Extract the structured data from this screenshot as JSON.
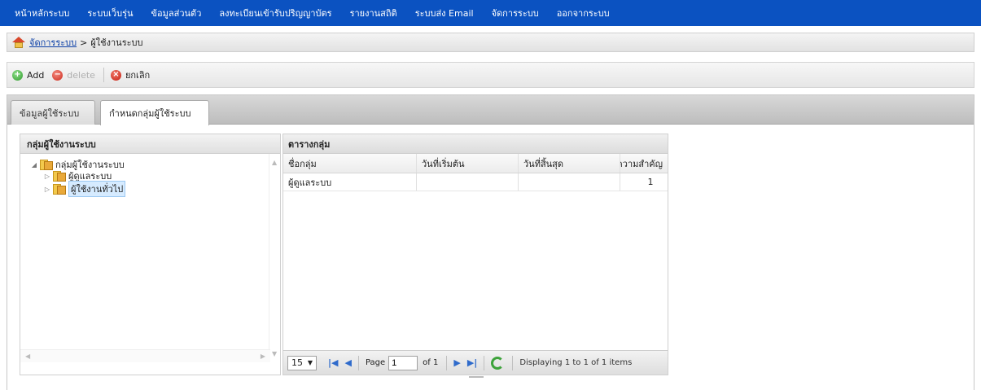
{
  "nav": {
    "items": [
      {
        "label": "หน้าหลักระบบ"
      },
      {
        "label": "ระบบเว็บรุ่น"
      },
      {
        "label": "ข้อมูลส่วนตัว"
      },
      {
        "label": "ลงทะเบียนเข้ารับปริญญาบัตร"
      },
      {
        "label": "รายงานสถิติ"
      },
      {
        "label": "ระบบส่ง Email"
      },
      {
        "label": "จัดการระบบ"
      },
      {
        "label": "ออกจากระบบ"
      }
    ]
  },
  "breadcrumb": {
    "link": "จัดการระบบ",
    "separator": ">",
    "current": "ผู้ใช้งานระบบ"
  },
  "toolbar": {
    "add": "Add",
    "delete": "delete",
    "cancel": "ยกเลิก"
  },
  "tabs": [
    {
      "label": "ข้อมูลผู้ใช้ระบบ"
    },
    {
      "label": "กำหนดกลุ่มผู้ใช้ระบบ"
    }
  ],
  "tree": {
    "title": "กลุ่มผู้ใช้งานระบบ",
    "root": "กลุ่มผู้ใช้งานระบบ",
    "children": [
      "ผู้ดูแลระบบ",
      "ผู้ใช้งานทั่วไป"
    ]
  },
  "grid": {
    "title": "ตารางกลุ่ม",
    "columns": [
      "ชื่อกลุ่ม",
      "วันที่เริ่มต้น",
      "วันที่สิ้นสุด",
      "ความสำคัญ"
    ],
    "rows": [
      {
        "name": "ผู้ดูแลระบบ",
        "start": "",
        "end": "",
        "priority": "1"
      }
    ]
  },
  "pager": {
    "page_size": "15",
    "page_label": "Page",
    "page_value": "1",
    "of_label": "of 1",
    "display": "Displaying 1 to 1 of 1 items"
  }
}
